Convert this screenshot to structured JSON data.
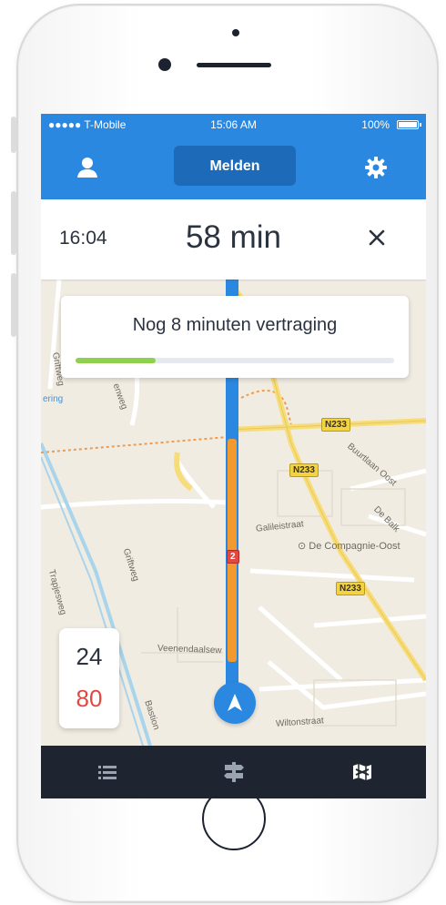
{
  "status_bar": {
    "carrier": "●●●●● T-Mobile",
    "time": "15:06 AM",
    "battery": "100%"
  },
  "nav_bar": {
    "report_button": "Melden",
    "icons": [
      "profile-icon",
      "settings-icon"
    ]
  },
  "eta": {
    "arrival_time": "16:04",
    "duration": "58 min"
  },
  "delay_card": {
    "message": "Nog 8 minuten vertraging",
    "progress": 0.25
  },
  "speed": {
    "current": "24",
    "limit": "80"
  },
  "map": {
    "street_labels": [
      "Griftweg",
      "enweg",
      "Griftweg",
      "Trapjesweg",
      "Veenendaalsew",
      "Bastion",
      "Galileistraat",
      "Buurtlaan Oost",
      "De Balk",
      "Wiltonstraat",
      "ering"
    ],
    "place_label": "De Compagnie-Oost",
    "road_badges": [
      "N233",
      "N233",
      "N233",
      "2"
    ]
  },
  "tab_bar": {
    "icons": [
      "list-icon",
      "signpost-icon",
      "map-icon"
    ]
  },
  "colors": {
    "primary_blue": "#2b88e0",
    "dark_blue": "#1d6bb8",
    "route_orange": "#f29a2e",
    "delay_green": "#8fd14f",
    "speed_limit_red": "#e4473f",
    "tab_bar": "#1f2530"
  }
}
